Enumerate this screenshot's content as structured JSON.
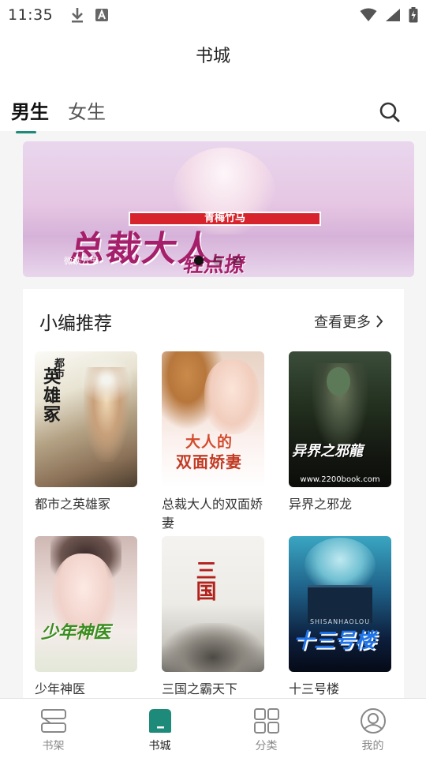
{
  "status_bar": {
    "time": "11:35"
  },
  "header": {
    "title": "书城"
  },
  "tabs": [
    {
      "label": "男生"
    },
    {
      "label": "女生"
    }
  ],
  "banner": {
    "tag": "青梅竹马",
    "title": "总裁大人",
    "subtitle": "轻点撩",
    "small_text": "微读云书",
    "page_count": 3,
    "active_index": 0
  },
  "section": {
    "title": "小编推荐",
    "more_label": "查看更多"
  },
  "books": [
    {
      "title": "都市之英雄冢"
    },
    {
      "title": "总裁大人的双面娇妻"
    },
    {
      "title": "异界之邪龙"
    },
    {
      "title": "少年神医"
    },
    {
      "title": "三国之霸天下"
    },
    {
      "title": "十三号楼"
    }
  ],
  "covers": {
    "c1_title": "英雄冢",
    "c1_top": "都市",
    "c2_title_line1": "大人的",
    "c2_title_line2": "双面娇妻",
    "c3_title": "异界之邪龍",
    "c3_url": "www.2200book.com",
    "c4_title": "少年神医",
    "c5_title": "三国",
    "c6_title": "十三号楼",
    "c6_roman": "SHISANHAOLOU"
  },
  "bottom_nav": [
    {
      "label": "书架",
      "icon": "bookshelf-icon"
    },
    {
      "label": "书城",
      "icon": "bookstore-icon"
    },
    {
      "label": "分类",
      "icon": "category-grid-icon"
    },
    {
      "label": "我的",
      "icon": "profile-icon"
    }
  ],
  "colors": {
    "accent": "#1d8a7a",
    "banner_title": "#a51f6b",
    "banner_tag": "#d7242c"
  }
}
